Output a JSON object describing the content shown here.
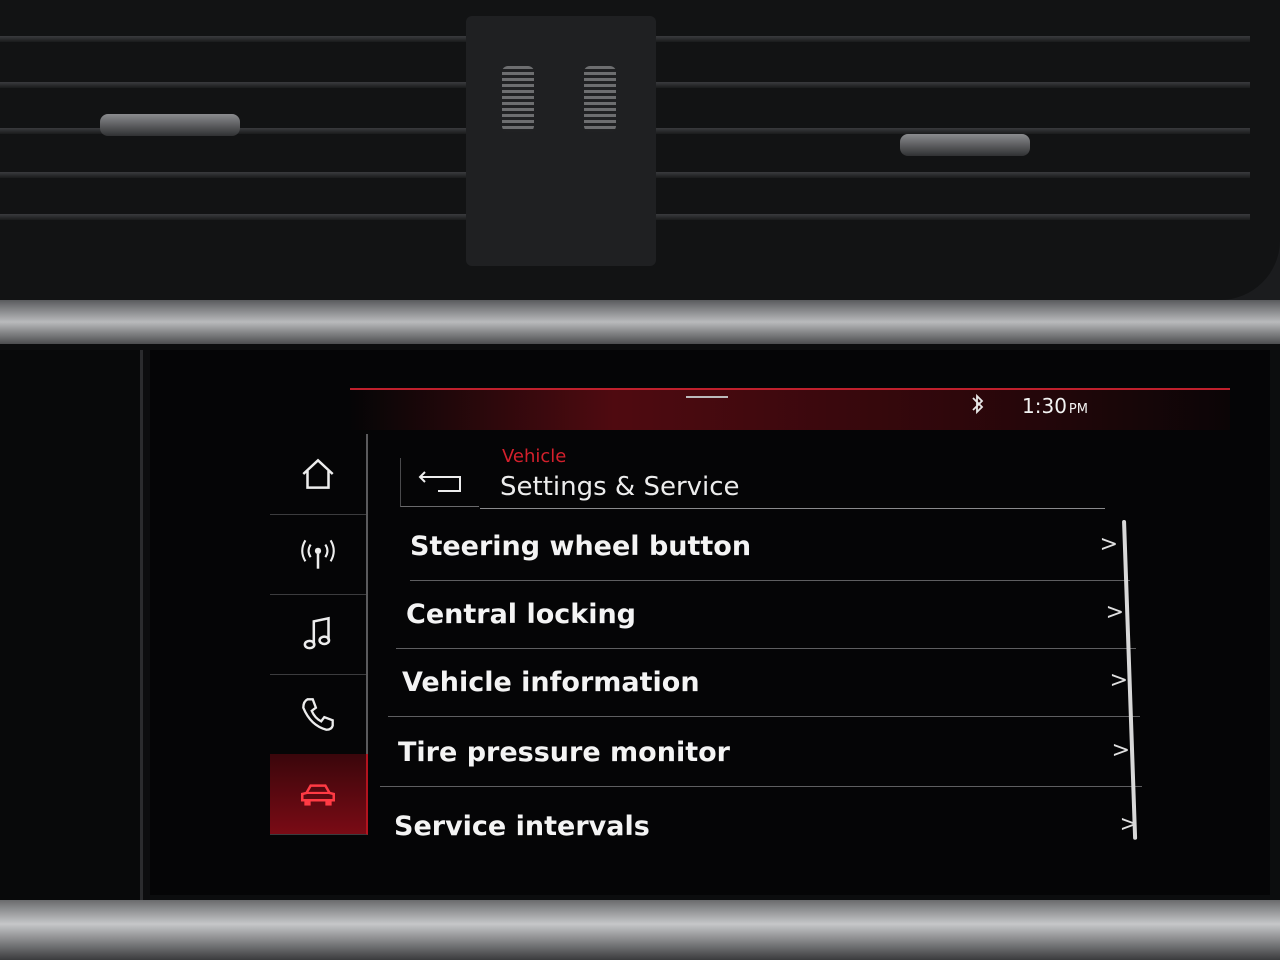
{
  "status_bar": {
    "bluetooth_icon": "bluetooth-icon",
    "time": "1:30",
    "ampm": "PM"
  },
  "side_nav": {
    "items": [
      {
        "name": "home",
        "icon": "home-icon"
      },
      {
        "name": "radio",
        "icon": "radio-antenna-icon"
      },
      {
        "name": "media",
        "icon": "music-note-icon"
      },
      {
        "name": "phone",
        "icon": "phone-icon"
      },
      {
        "name": "vehicle",
        "icon": "car-icon",
        "active": true
      }
    ]
  },
  "header": {
    "breadcrumb": "Vehicle",
    "title": "Settings & Service",
    "back_icon": "back-arrow-icon"
  },
  "menu": {
    "items": [
      {
        "label": "Steering wheel button",
        "chevron": ">"
      },
      {
        "label": "Central locking",
        "chevron": ">"
      },
      {
        "label": "Vehicle information",
        "chevron": ">"
      },
      {
        "label": "Tire pressure monitor",
        "chevron": ">"
      },
      {
        "label": "Service intervals",
        "chevron": ">"
      }
    ]
  },
  "colors": {
    "accent": "#d4202c",
    "active_nav": "#7a0b15",
    "text": "#f4f4f4",
    "background": "#050506"
  }
}
